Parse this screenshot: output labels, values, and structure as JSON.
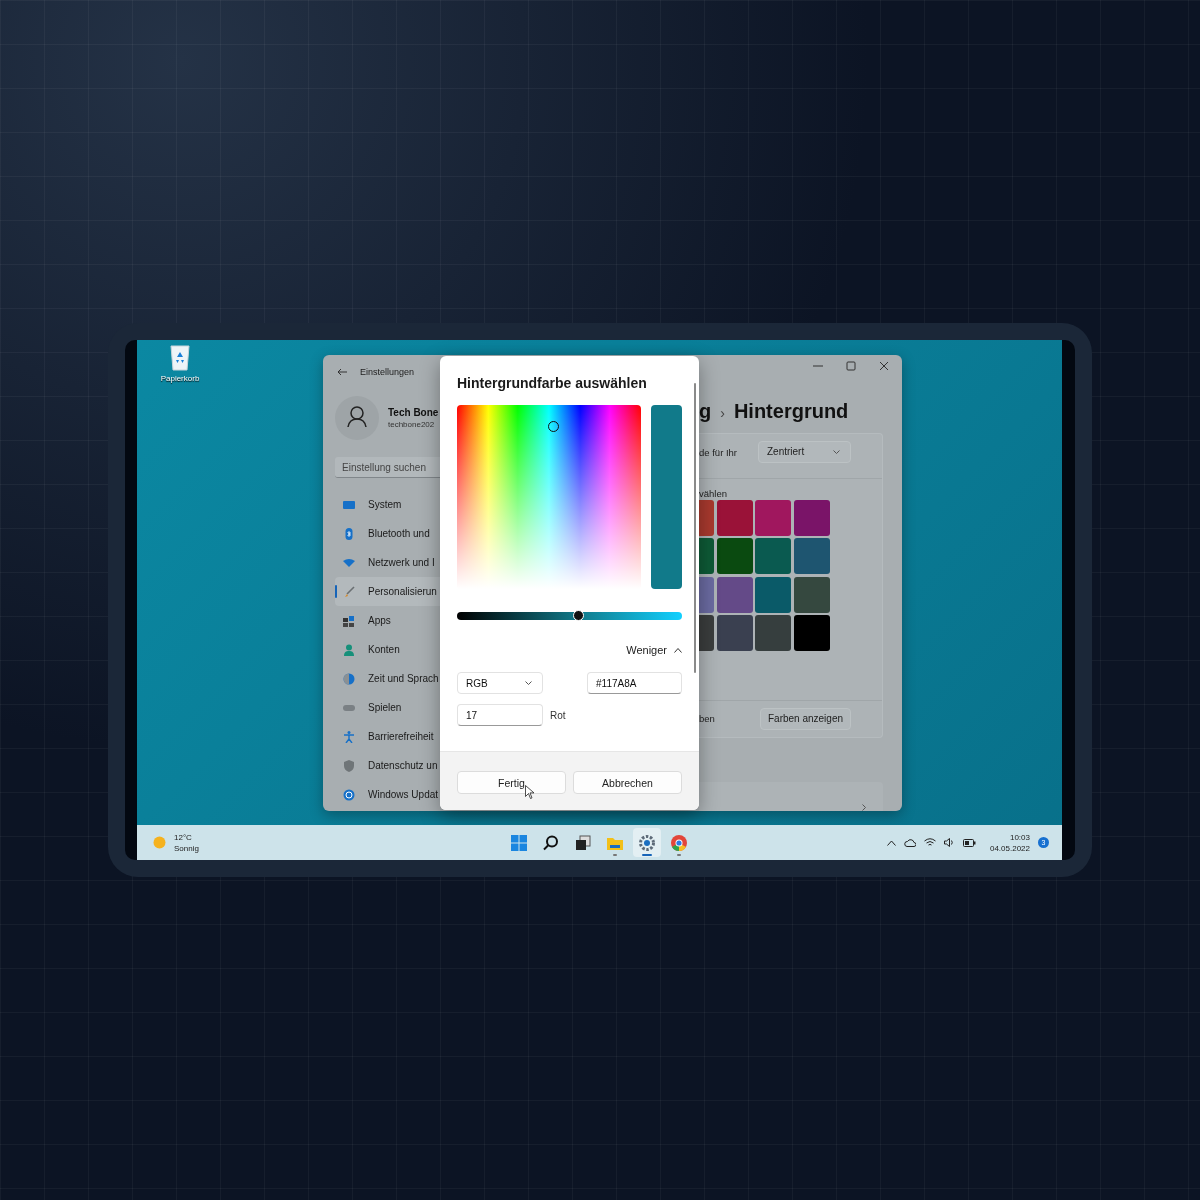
{
  "desktop": {
    "icons": [
      {
        "label": "Papierkorb"
      }
    ]
  },
  "settings_window": {
    "title": "Einstellungen",
    "user": {
      "name": "Tech Bone",
      "email": "techbone202"
    },
    "search": {
      "placeholder": "Einstellung suchen"
    },
    "nav_items": [
      {
        "label": "System",
        "kind": "system",
        "selected": false
      },
      {
        "label": "Bluetooth und",
        "kind": "bluetooth",
        "selected": false
      },
      {
        "label": "Netzwerk und I",
        "kind": "network",
        "selected": false
      },
      {
        "label": "Personalisierun",
        "kind": "personalization",
        "selected": true
      },
      {
        "label": "Apps",
        "kind": "apps",
        "selected": false
      },
      {
        "label": "Konten",
        "kind": "accounts",
        "selected": false
      },
      {
        "label": "Zeit und Sprach",
        "kind": "time",
        "selected": false
      },
      {
        "label": "Spielen",
        "kind": "gaming",
        "selected": false
      },
      {
        "label": "Barrierefreiheit",
        "kind": "accessibility",
        "selected": false
      },
      {
        "label": "Datenschutz un",
        "kind": "privacy",
        "selected": false
      },
      {
        "label": "Windows Updat",
        "kind": "update",
        "selected": false
      }
    ],
    "breadcrumb": {
      "parent": "g",
      "separator": "›",
      "current": "Hintergrund"
    },
    "fit_setting": {
      "label": "de für Ihr",
      "value": "Zentriert"
    },
    "colors_label": "vählen",
    "swatches": [
      {
        "color": "#a8392e"
      },
      {
        "color": "#9a1238"
      },
      {
        "color": "#a0175e"
      },
      {
        "color": "#7a1468"
      },
      {
        "color": "#0e5a36"
      },
      {
        "color": "#0a4a10"
      },
      {
        "color": "#0a5a50"
      },
      {
        "color": "#1e5570"
      },
      {
        "color": "#6a6aa0"
      },
      {
        "color": "#644a88"
      },
      {
        "color": "#0a5a68"
      },
      {
        "color": "#35483f"
      },
      {
        "color": "#3a3d3d"
      },
      {
        "color": "#3a4050"
      },
      {
        "color": "#363e3e"
      },
      {
        "color": "#000000"
      }
    ],
    "custom_colors": {
      "label": "ben",
      "button": "Farben anzeigen"
    }
  },
  "dialog": {
    "title": "Hintergrundfarbe auswählen",
    "color": "#117a8a",
    "brightness": {
      "level": 0.54
    },
    "toggle": {
      "label": "Weniger",
      "expanded": true
    },
    "mode": "RGB",
    "hex": "#117A8A",
    "channel": {
      "value": "17",
      "label": "Rot"
    },
    "buttons": [
      "Fertig",
      "Abbrechen"
    ]
  },
  "taskbar": {
    "weather": {
      "temperature": "12°C",
      "condition": "Sonnig"
    },
    "apps": [
      {
        "kind": "start",
        "running": false,
        "selected": false
      },
      {
        "kind": "search",
        "running": false,
        "selected": false
      },
      {
        "kind": "taskview",
        "running": false,
        "selected": false
      },
      {
        "kind": "explorer",
        "running": true,
        "selected": false
      },
      {
        "kind": "settings",
        "running": true,
        "selected": true
      },
      {
        "kind": "browser",
        "running": true,
        "selected": false
      }
    ],
    "time": "10:03",
    "date": "04.05.2022",
    "notifications": "3"
  }
}
